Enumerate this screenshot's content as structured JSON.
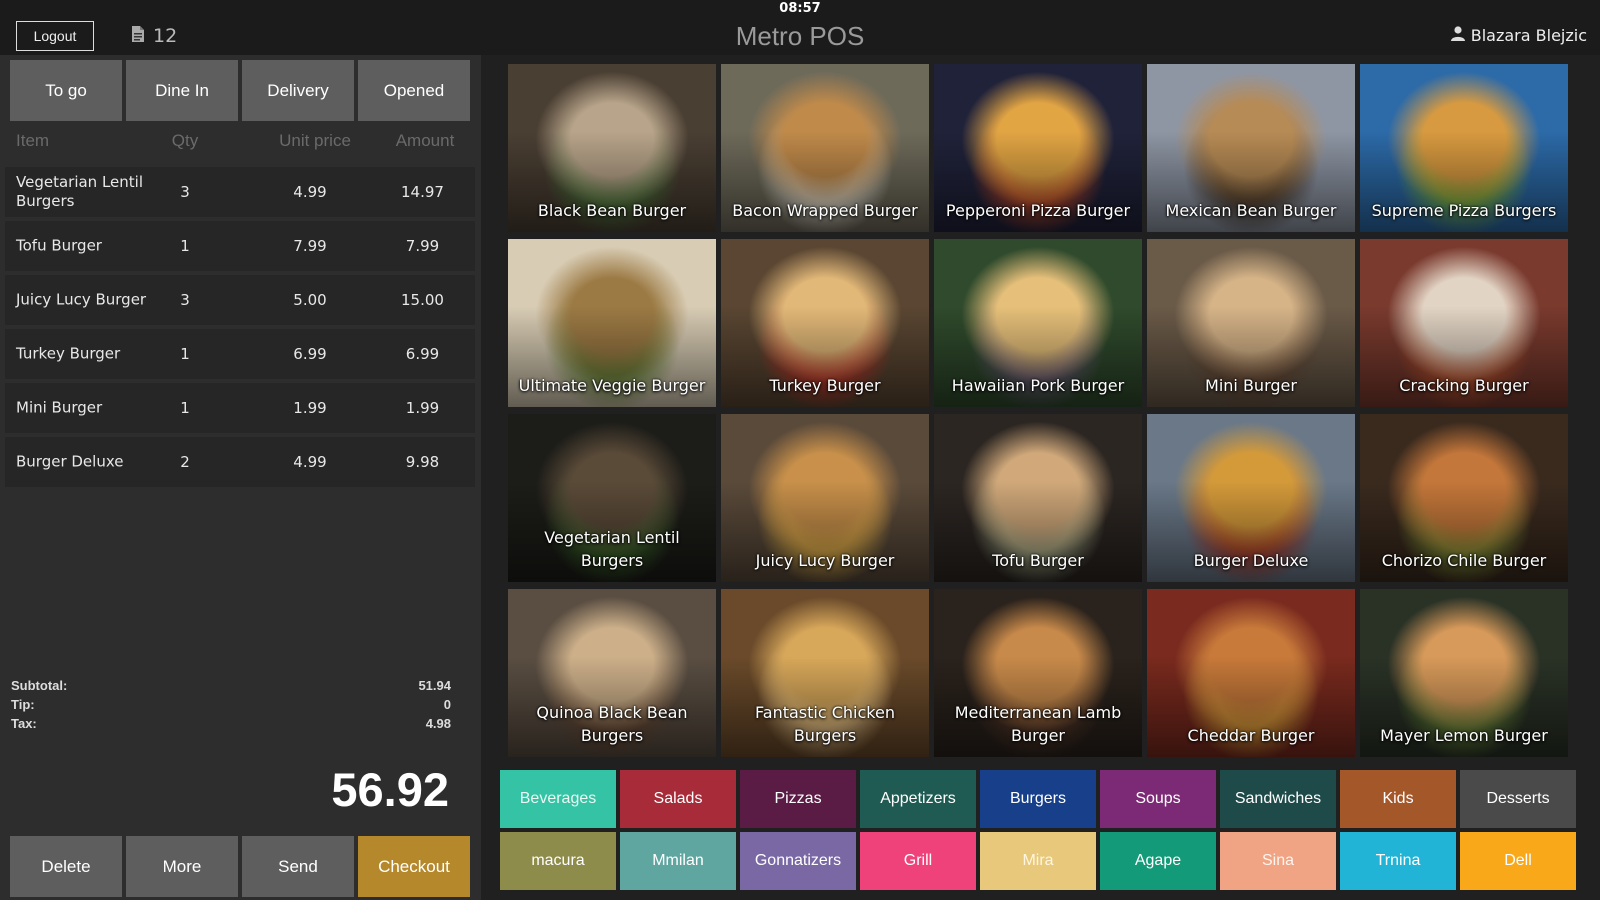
{
  "header": {
    "clock": "08:57",
    "title": "Metro POS",
    "logout_label": "Logout",
    "order_number": "12",
    "user_name": "Blazara Blejzic"
  },
  "order_modes": [
    "To go",
    "Dine In",
    "Delivery",
    "Opened"
  ],
  "order_table": {
    "columns": {
      "item": "Item",
      "qty": "Qty",
      "unit_price": "Unit price",
      "amount": "Amount"
    },
    "rows": [
      {
        "item": "Vegetarian Lentil Burgers",
        "qty": "3",
        "unit_price": "4.99",
        "amount": "14.97"
      },
      {
        "item": "Tofu Burger",
        "qty": "1",
        "unit_price": "7.99",
        "amount": "7.99"
      },
      {
        "item": "Juicy Lucy Burger",
        "qty": "3",
        "unit_price": "5.00",
        "amount": "15.00"
      },
      {
        "item": "Turkey Burger",
        "qty": "1",
        "unit_price": "6.99",
        "amount": "6.99"
      },
      {
        "item": "Mini Burger",
        "qty": "1",
        "unit_price": "1.99",
        "amount": "1.99"
      },
      {
        "item": "Burger Deluxe",
        "qty": "2",
        "unit_price": "4.99",
        "amount": "9.98"
      }
    ]
  },
  "totals": {
    "subtotal_label": "Subtotal:",
    "subtotal": "51.94",
    "tip_label": "Tip:",
    "tip": "0",
    "tax_label": "Tax:",
    "tax": "4.98",
    "grand_total": "56.92"
  },
  "actions": {
    "delete": "Delete",
    "more": "More",
    "send": "Send",
    "checkout": "Checkout"
  },
  "products": [
    {
      "name": "Black Bean Burger",
      "bg": "#4a3f33",
      "c1": "#b8a48a",
      "c2": "#4c7a3a"
    },
    {
      "name": "Bacon Wrapped Burger",
      "bg": "#6e6a5a",
      "c1": "#c08a4a",
      "c2": "#eae6d8"
    },
    {
      "name": "Pepperoni Pizza Burger",
      "bg": "#20223a",
      "c1": "#e2a544",
      "c2": "#c24a2a"
    },
    {
      "name": "Mexican Bean Burger",
      "bg": "#8e96a4",
      "c1": "#b78b55",
      "c2": "#4b3a2c"
    },
    {
      "name": "Supreme Pizza Burgers",
      "bg": "#2c6aa8",
      "c1": "#d89a40",
      "c2": "#7ab844"
    },
    {
      "name": "Ultimate Veggie Burger",
      "bg": "#d8ccb4",
      "c1": "#9c7a44",
      "c2": "#6f8f3e"
    },
    {
      "name": "Turkey Burger",
      "bg": "#5a4632",
      "c1": "#e2b878",
      "c2": "#c8382a"
    },
    {
      "name": "Hawaiian Pork Burger",
      "bg": "#2f4a2c",
      "c1": "#e6c07a",
      "c2": "#6a5d78"
    },
    {
      "name": "Mini Burger",
      "bg": "#6a5a48",
      "c1": "#d6b488",
      "c2": "#6a4a36"
    },
    {
      "name": "Cracking Burger",
      "bg": "#7a3a2e",
      "c1": "#e2d4c4",
      "c2": "#c2552e"
    },
    {
      "name": "Vegetarian Lentil Burgers",
      "bg": "#1c1c18",
      "c1": "#5a4a38",
      "c2": "#3c6a2a"
    },
    {
      "name": "Juicy Lucy Burger",
      "bg": "#5a4a3a",
      "c1": "#c8904a",
      "c2": "#e6b44a"
    },
    {
      "name": "Tofu Burger",
      "bg": "#2c2622",
      "c1": "#d0a87a",
      "c2": "#aab08c"
    },
    {
      "name": "Burger Deluxe",
      "bg": "#6a7888",
      "c1": "#d49a3a",
      "c2": "#b03a2a"
    },
    {
      "name": "Chorizo Chile Burger",
      "bg": "#3a2a1e",
      "c1": "#c4773a",
      "c2": "#8a9a3a"
    },
    {
      "name": "Quinoa Black Bean Burgers",
      "bg": "#5a4e42",
      "c1": "#cdb08a",
      "c2": "#6a4a34"
    },
    {
      "name": "Fantastic Chicken Burgers",
      "bg": "#6a4a2a",
      "c1": "#d8a85a",
      "c2": "#e8c48a"
    },
    {
      "name": "Mediterranean Lamb Burger",
      "bg": "#2a221c",
      "c1": "#c88a4a",
      "c2": "#5a3a2a"
    },
    {
      "name": "Cheddar Burger",
      "bg": "#7a2a1e",
      "c1": "#c87a3a",
      "c2": "#e2a43a"
    },
    {
      "name": "Mayer Lemon Burger",
      "bg": "#2a3226",
      "c1": "#d89a5a",
      "c2": "#6a8a3a"
    }
  ],
  "categories": [
    {
      "label": "Beverages",
      "color": "#34c3a4",
      "text": "#eaf7f2"
    },
    {
      "label": "Salads",
      "color": "#a72b38",
      "text": "#ffffff"
    },
    {
      "label": "Pizzas",
      "color": "#5a1c44",
      "text": "#ffffff"
    },
    {
      "label": "Appetizers",
      "color": "#1f5b52",
      "text": "#ffffff"
    },
    {
      "label": "Burgers",
      "color": "#173f8a",
      "text": "#ffffff"
    },
    {
      "label": "Soups",
      "color": "#7c2a76",
      "text": "#ffffff"
    },
    {
      "label": "Sandwiches",
      "color": "#1e4a4a",
      "text": "#ffffff"
    },
    {
      "label": "Kids",
      "color": "#a4582a",
      "text": "#ffffff"
    },
    {
      "label": "Desserts",
      "color": "#4a4a4a",
      "text": "#ffffff"
    },
    {
      "label": "macura",
      "color": "#8e8c4a",
      "text": "#ffffff"
    },
    {
      "label": "Mmilan",
      "color": "#5fa5a0",
      "text": "#ffffff"
    },
    {
      "label": "Gonnatizers",
      "color": "#7a68a4",
      "text": "#ffffff"
    },
    {
      "label": "Grill",
      "color": "#f0427a",
      "text": "#ffffff"
    },
    {
      "label": "Mira",
      "color": "#e8c87a",
      "text": "#fff6e0"
    },
    {
      "label": "Agape",
      "color": "#139a78",
      "text": "#ffffff"
    },
    {
      "label": "Sina",
      "color": "#f0a484",
      "text": "#fff4ee"
    },
    {
      "label": "Trnina",
      "color": "#22b4d6",
      "text": "#ffffff"
    },
    {
      "label": "Dell",
      "color": "#f8a818",
      "text": "#ffffff"
    }
  ],
  "icons": {
    "order": "document-icon",
    "user": "user-icon"
  }
}
